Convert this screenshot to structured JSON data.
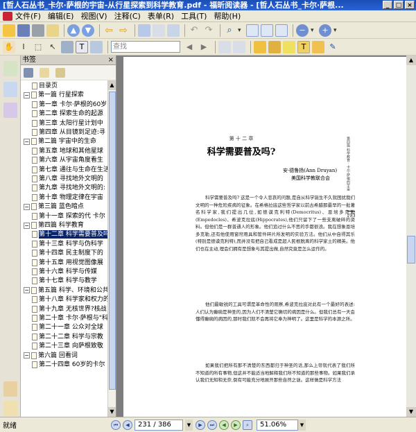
{
  "window": {
    "title": "[哲人石丛书_卡尔·萨根的宇宙-从行星探索到科学教育.pdf - 福昕阅读器 - [哲人石丛书_卡尔·萨根..."
  },
  "menu": [
    "文件(F)",
    "编辑(E)",
    "视图(V)",
    "注释(C)",
    "表单(R)",
    "工具(T)",
    "帮助(H)"
  ],
  "search": {
    "placeholder": "查找"
  },
  "bookmarks": {
    "header": "书签",
    "close": "×",
    "items": [
      {
        "label": "目录页",
        "level": 1
      },
      {
        "label": "第一篇 行星探索",
        "level": 0
      },
      {
        "label": "第一章 卡尔·萨根的60岁",
        "level": 1
      },
      {
        "label": "第二章 探索生命的起源",
        "level": 1
      },
      {
        "label": "第三章 太阳行星计划中",
        "level": 1
      },
      {
        "label": "第四章 从目镜到足迹:寻",
        "level": 1
      },
      {
        "label": "第二篇 宇宙中的生命",
        "level": 0
      },
      {
        "label": "第五章 地球和其他星球",
        "level": 1
      },
      {
        "label": "第六章 从宇宙角度看生",
        "level": 1
      },
      {
        "label": "第七章 通往与生命在生活",
        "level": 1
      },
      {
        "label": "第八章 寻找地外文明的",
        "level": 1
      },
      {
        "label": "第九章 寻找地外文明的:",
        "level": 1
      },
      {
        "label": "第十章 物理定律在宇宙",
        "level": 1
      },
      {
        "label": "第三篇 蓝色暗点",
        "level": 0
      },
      {
        "label": "第十一章 探索的代 卡尔",
        "level": 1
      },
      {
        "label": "第四篇 科学教育",
        "level": 0
      },
      {
        "label": "第十二章 科学需要普及吗",
        "level": 1,
        "selected": true
      },
      {
        "label": "第十三章 科学与伪科学",
        "level": 1
      },
      {
        "label": "第十四章 民主制度下的",
        "level": 1
      },
      {
        "label": "第十五章 用视觉图像展",
        "level": 1
      },
      {
        "label": "第十六章 科学与传媒 ",
        "level": 1
      },
      {
        "label": "第十七章 科学与教学 ",
        "level": 1
      },
      {
        "label": "第五篇 科学、环境和公共政",
        "level": 0
      },
      {
        "label": "第十八章 科学家和权力的",
        "level": 1
      },
      {
        "label": "第十九章 无核世界?核战",
        "level": 1
      },
      {
        "label": "第二十章 卡尔·萨根与\"科",
        "level": 1
      },
      {
        "label": "第二十一章 公众对全球",
        "level": 1
      },
      {
        "label": "第二十二章 科学与宗教",
        "level": 1
      },
      {
        "label": "第二十三章 向萨根致敬",
        "level": 1
      },
      {
        "label": "第六篇 回看词",
        "level": 0
      },
      {
        "label": "第二十四章 60岁的卡尔",
        "level": 1
      }
    ]
  },
  "document": {
    "chapter_no": "第 十 二 章",
    "chapter_title": "科学需要普及吗?",
    "author": "安·德鲁扬(Ann Druyan)",
    "affiliation": "美国科学教联合会",
    "side_header": "第四篇 科学教育 · 卡尔·萨根的宇宙",
    "page_number": "193",
    "paragraphs": [
      "科学需要普及吗? 这是一个令人悲哀的问题,是自从科学诞生不久就困扰我们文明的一种危险疾病的征象。在希格拉底这些哲学家以前古希腊那最早的一批著名科学家,我们提出几位,如德谟克利特(Democritus)、恩培多克勒(Empedocles)、希波克拉底(Hippocrates),他们只留下了一些支离破碎的资料。但他们是一群普通人的形象。他们追过什么不思的手都很浪。我在想象恩培多克勒,还有他使用窗帘用具和管件碎片所发明的实验方法。他们从中自得其乐(特别是德谟克利特),而并没有把自己看成是超人民根脱离的科学家土的精英。他们也在主动,理会们拥有是想象与其提出做,自然究竟是怎么运作的。",
      "他们最敏锐的工具可谓是革命性的观察,希波克拉底对此有一个最好的表述:人们认为癫痫是神圣的,因为人们不清楚它确切的病因是什么。但我们总有一天会懂得癫痫的病因的,那时我们就不会再将它奉为神明了。这里是科学的本源之所。",
      "如果我们把所有那不清楚的东西都归于神圣的话,那么上帝就代表了我们所不知道的所有事物,但这并不能适当地解释我们所不知道的那些事物。如果我们承认我们无知和无奈,倒有可能充分地展开那些自然之谜。这样做是科学方法"
    ]
  },
  "status": {
    "text": "就绪",
    "page_field": "231 / 386",
    "zoom": "51.06%"
  }
}
